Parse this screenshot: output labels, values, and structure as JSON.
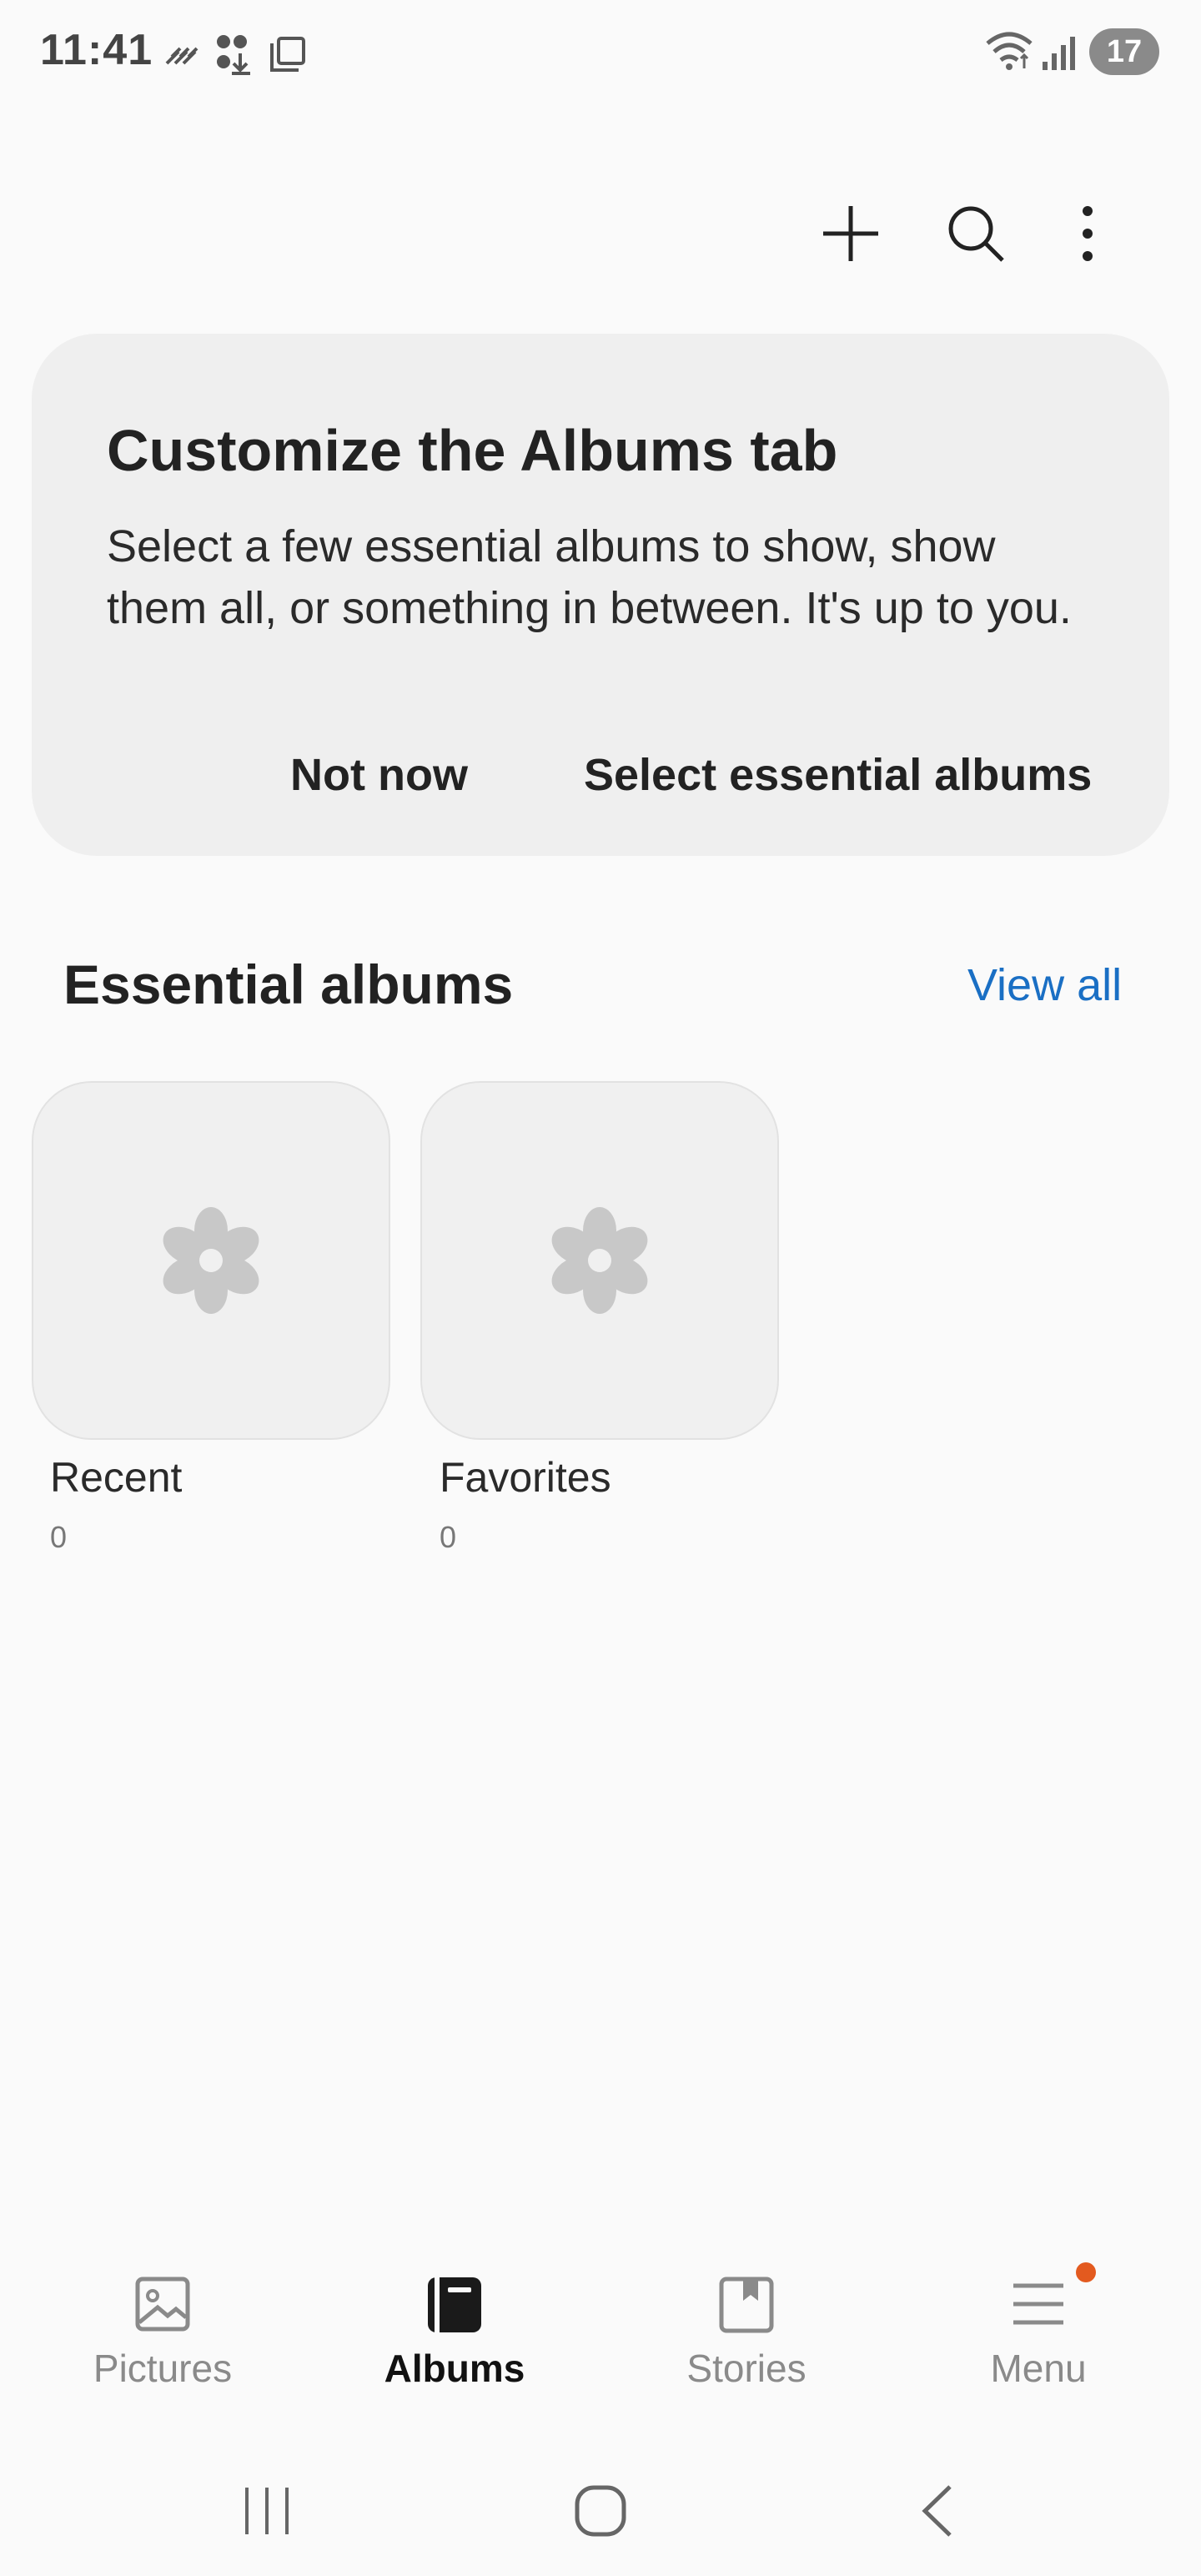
{
  "status_bar": {
    "time": "11:41",
    "battery": "17",
    "icons": [
      "vpn-icon",
      "download-icon",
      "screenshot-icon",
      "wifi-icon",
      "signal-icon"
    ]
  },
  "toolbar": {
    "actions": [
      "add-icon",
      "search-icon",
      "more-options-icon"
    ]
  },
  "customize_card": {
    "title": "Customize the Albums tab",
    "body": "Select a few essential albums to show, show them all, or something in between. It's up to you.",
    "not_now_label": "Not now",
    "select_label": "Select essential albums"
  },
  "essential_albums": {
    "title": "Essential albums",
    "view_all_label": "View all",
    "albums": [
      {
        "name": "Recent",
        "count": "0",
        "icon": "flower-placeholder-icon"
      },
      {
        "name": "Favorites",
        "count": "0",
        "icon": "flower-placeholder-icon"
      }
    ]
  },
  "bottom_nav": {
    "items": [
      {
        "label": "Pictures",
        "icon": "pictures-icon",
        "active": false
      },
      {
        "label": "Albums",
        "icon": "albums-icon",
        "active": true
      },
      {
        "label": "Stories",
        "icon": "stories-icon",
        "active": false
      },
      {
        "label": "Menu",
        "icon": "menu-icon",
        "active": false,
        "badge": true
      }
    ]
  },
  "system_nav": {
    "buttons": [
      "recents-icon",
      "home-icon",
      "back-icon"
    ]
  },
  "colors": {
    "background": "#fafafa",
    "card": "#efefef",
    "link": "#1a6fc4",
    "badge": "#e35a1f"
  }
}
